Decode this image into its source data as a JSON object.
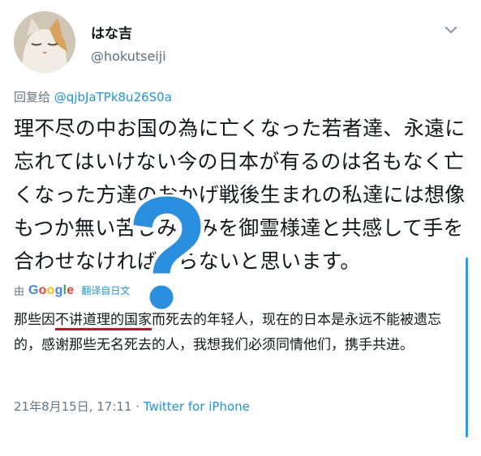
{
  "tweet": {
    "display_name": "はな吉",
    "handle": "@hokutseiji",
    "reply_prefix": "回复给",
    "reply_mention": "@qjbJaTPk8u26S0a",
    "text": "理不尽の中お国の為に亡くなった若者達、永遠に忘れてはいけない今の日本が有るのは名もなく亡くなった方達のおかげ戦後生まれの私達には想像もつか無い苦しみ痛みを御霊様達と共感して手を合わせなければならないと思います。",
    "translate_by": "由",
    "translate_provider": "Google",
    "translate_link": "翻译自日文",
    "translation_before": "那些因",
    "translation_underlined": "不讲道理的国家",
    "translation_after": "而死去的年轻人，现在的日本是永远不能被遗忘的，感谢那些无名死去的人，我想我们必须同情他们，携手共进。",
    "timestamp": "21年8月15日, 17:11 · ",
    "source": "Twitter for iPhone"
  },
  "icons": {
    "avatar": "cat-avatar",
    "menu": "chevron-down-icon",
    "overlay": "question-mark-icon"
  },
  "colors": {
    "link_blue": "#1b95e0",
    "muted_gray": "#657786",
    "underline_red": "#d0101a",
    "question_blue": "#2b8fe0"
  }
}
